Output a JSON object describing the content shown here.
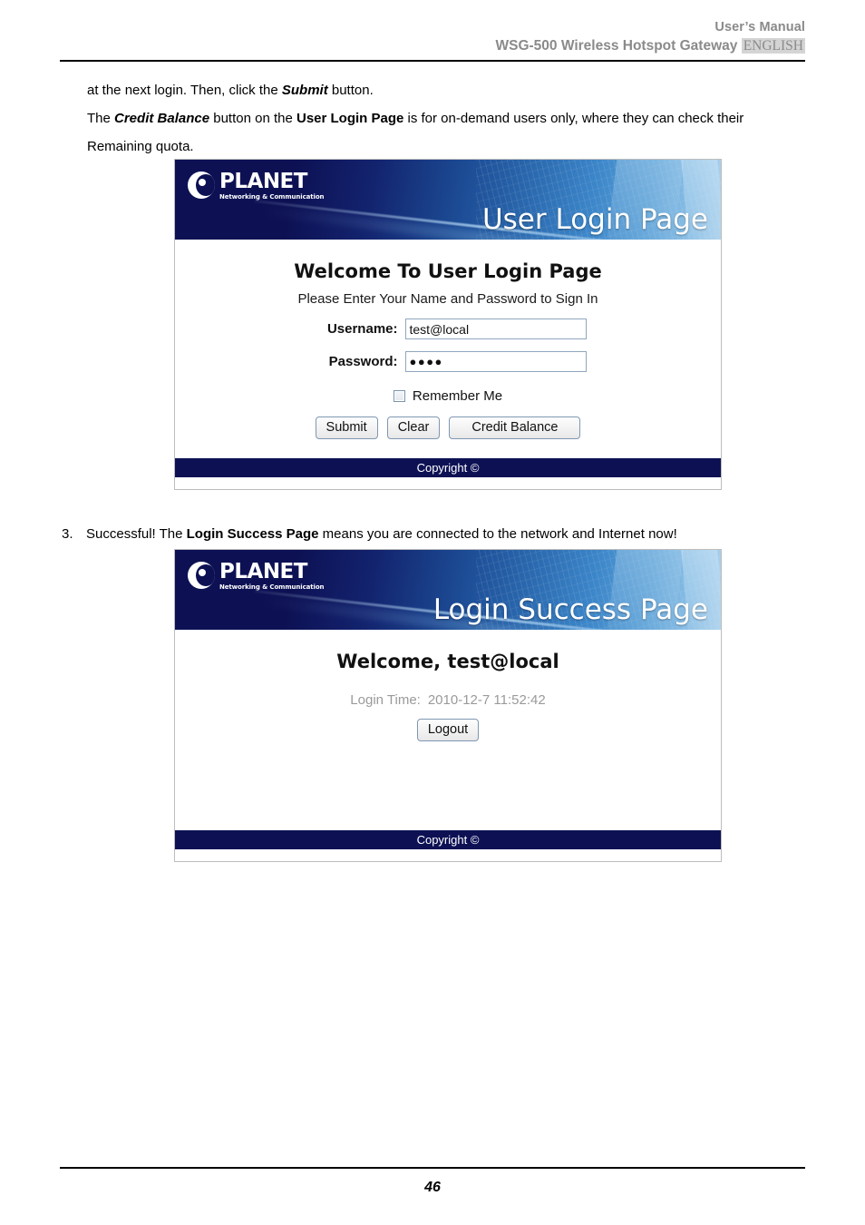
{
  "header": {
    "manual_label": "User’s Manual",
    "product_line": "WSG-500 Wireless Hotspot Gateway",
    "language": "ENGLISH"
  },
  "body": {
    "para1_pre": "at the next login. Then, click the ",
    "para1_bold": "Submit",
    "para1_post": " button.",
    "para2_pre": "The ",
    "para2_bi": "Credit Balance",
    "para2_mid": " button on the ",
    "para2_bold": "User Login Page",
    "para2_post": " is for on-demand users only, where they can check their Remaining quota."
  },
  "step": {
    "number": "3.",
    "text_pre": "Successful! The ",
    "text_bold": "Login Success Page",
    "text_post": " means you are connected to the network and Internet now!"
  },
  "login_page": {
    "brand_name": "PLANET",
    "brand_tagline": "Networking & Communication",
    "banner_title": "User Login Page",
    "heading": "Welcome To User Login Page",
    "subheading": "Please Enter Your Name and Password to Sign In",
    "username_label": "Username:",
    "username_value": "test@local",
    "password_label": "Password:",
    "password_value": "●●●●",
    "remember_label": "Remember Me",
    "submit_label": "Submit",
    "clear_label": "Clear",
    "credit_balance_label": "Credit Balance",
    "copyright": "Copyright ©"
  },
  "success_page": {
    "brand_name": "PLANET",
    "brand_tagline": "Networking & Communication",
    "banner_title": "Login Success Page",
    "welcome": "Welcome, test@local",
    "login_time_label": "Login Time:",
    "login_time_value": "2010-12-7 11:52:42",
    "logout_label": "Logout",
    "copyright": "Copyright ©"
  },
  "footer": {
    "page_number": "46"
  },
  "colors": {
    "banner_navy": "#0d1154",
    "banner_blue": "#3c86c9",
    "footer_navy": "#0d1154",
    "input_border": "#8fa6bf",
    "button_border": "#7e97b3",
    "muted_text": "#9a9a9a",
    "header_gray": "#8a8a8a",
    "lang_highlight": "#d4d4d4"
  }
}
